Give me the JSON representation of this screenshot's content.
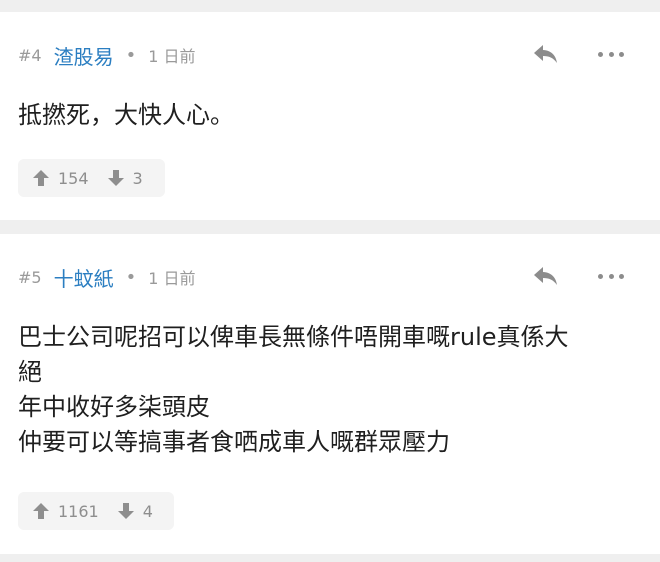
{
  "posts": [
    {
      "number": "#4",
      "username": "渣股易",
      "separator": "•",
      "time": "1 日前",
      "lines": [
        "抵撚死，大快人心。"
      ],
      "upvotes": "154",
      "downvotes": "3"
    },
    {
      "number": "#5",
      "username": "十蚊紙",
      "separator": "•",
      "time": "1 日前",
      "lines": [
        "巴士公司呢招可以俾車長無條件唔開車嘅rule真係大",
        "絕",
        "年中收好多柒頭皮",
        "仲要可以等搞事者食哂成車人嘅群眾壓力"
      ],
      "upvotes": "1161",
      "downvotes": "4"
    }
  ],
  "icons": {
    "reply": "reply-icon",
    "more": "more-icon",
    "upvote": "arrow-up-icon",
    "downvote": "arrow-down-icon"
  },
  "colors": {
    "username": "#2b7ec1",
    "meta": "#9a9a9a",
    "text": "#1f1f1f",
    "vote_bg": "#f4f4f4",
    "page_bg": "#efefef"
  }
}
